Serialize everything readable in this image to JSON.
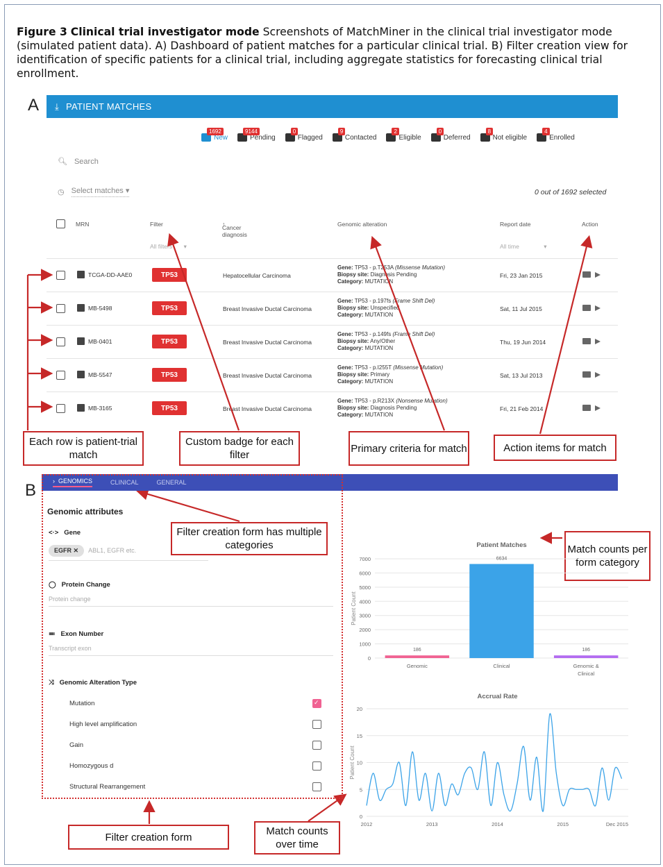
{
  "caption": {
    "label": "Figure 3",
    "title": "Clinical trial investigator mode",
    "text": "Screenshots of MatchMiner in the clinical trial investigator mode (simulated patient data). A) Dashboard of patient matches for a particular clinical trial. B) Filter creation view for identification of specific patients for a clinical trial, including aggregate statistics for forecasting clinical trial enrollment."
  },
  "panel_a": {
    "letter": "A",
    "header": "PATIENT MATCHES",
    "statuses": [
      {
        "label": "New",
        "count": "1692",
        "color": "#1f8fd1"
      },
      {
        "label": "Pending",
        "count": "9144",
        "color": "#333333"
      },
      {
        "label": "Flagged",
        "count": "0",
        "color": "#333333"
      },
      {
        "label": "Contacted",
        "count": "9",
        "color": "#333333"
      },
      {
        "label": "Eligible",
        "count": "2",
        "color": "#333333"
      },
      {
        "label": "Deferred",
        "count": "0",
        "color": "#333333"
      },
      {
        "label": "Not eligible",
        "count": "8",
        "color": "#333333"
      },
      {
        "label": "Enrolled",
        "count": "4",
        "color": "#333333"
      }
    ],
    "search_placeholder": "Search",
    "select_matches": "Select matches",
    "selected_count": "0 out of 1692 selected",
    "columns": {
      "mrn": "MRN",
      "filter": "Filter",
      "cancer": "Cancer diagnosis",
      "genomic": "Genomic alteration",
      "report": "Report date",
      "action": "Action"
    },
    "filter_all": "All filters",
    "time_all": "All time",
    "rows": [
      {
        "mrn": "TCGA-DD-AAE0",
        "badge": "TP53",
        "diagnosis": "Hepatocellular Carcinoma",
        "gene": "TP53 - p.T253A",
        "gene_type": "(Missense Mutation)",
        "biopsy": "Diagnosis Pending",
        "category": "MUTATION",
        "date": "Fri, 23 Jan 2015"
      },
      {
        "mrn": "MB-5498",
        "badge": "TP53",
        "diagnosis": "Breast Invasive Ductal Carcinoma",
        "gene": "TP53 - p.197fs",
        "gene_type": "(Frame Shift Del)",
        "biopsy": "Unspecified",
        "category": "MUTATION",
        "date": "Sat, 11 Jul 2015"
      },
      {
        "mrn": "MB-0401",
        "badge": "TP53",
        "diagnosis": "Breast Invasive Ductal Carcinoma",
        "gene": "TP53 - p.149fs",
        "gene_type": "(Frame Shift Del)",
        "biopsy": "Any/Other",
        "category": "MUTATION",
        "date": "Thu, 19 Jun 2014"
      },
      {
        "mrn": "MB-5547",
        "badge": "TP53",
        "diagnosis": "Breast Invasive Ductal Carcinoma",
        "gene": "TP53 - p.I255T",
        "gene_type": "(Missense Mutation)",
        "biopsy": "Primary",
        "category": "MUTATION",
        "date": "Sat, 13 Jul 2013"
      },
      {
        "mrn": "MB-3165",
        "badge": "TP53",
        "diagnosis": "Breast Invasive Ductal Carcinoma",
        "gene": "TP53 - p.R213X",
        "gene_type": "(Nonsense Mutation)",
        "biopsy": "Diagnosis Pending",
        "category": "MUTATION",
        "date": "Fri, 21 Feb 2014"
      }
    ],
    "labels": {
      "gene": "Gene:",
      "biopsy": "Biopsy site:",
      "category": "Category:"
    },
    "callouts": {
      "rows": "Each row is patient-trial match",
      "badge": "Custom badge for each filter",
      "criteria": "Primary criteria for match",
      "actions": "Action items for match"
    }
  },
  "panel_b": {
    "letter": "B",
    "tabs": [
      "GENOMICS",
      "CLINICAL",
      "GENERAL"
    ],
    "form_title": "Genomic attributes",
    "gene_label": "Gene",
    "gene_chip": "EGFR",
    "gene_hint": "ABL1, EGFR etc.",
    "protein_label": "Protein Change",
    "protein_hint": "Protein change",
    "exon_label": "Exon Number",
    "exon_hint": "Transcript exon",
    "alt_type_label": "Genomic Alteration Type",
    "alt_types": [
      {
        "label": "Mutation",
        "checked": true
      },
      {
        "label": "High level amplification",
        "checked": false
      },
      {
        "label": "Gain",
        "checked": false
      },
      {
        "label": "Homozygous d",
        "checked": false
      },
      {
        "label": "Structural Rearrangement",
        "checked": false
      }
    ],
    "callouts": {
      "categories": "Filter creation form has multiple categories",
      "match_counts": "Match counts per form category",
      "form": "Filter creation form",
      "over_time": "Match counts over time"
    }
  },
  "chart_data": [
    {
      "type": "bar",
      "title": "Patient Matches",
      "ylabel": "Patient Count",
      "xlabel": "",
      "categories": [
        "Genomic",
        "Clinical",
        "Genomic & Clinical"
      ],
      "values": [
        186,
        6634,
        186
      ],
      "colors": [
        "#f06292",
        "#3ba3e8",
        "#b36cf0"
      ],
      "ylim": [
        0,
        7000
      ],
      "yticks": [
        0,
        1000,
        2000,
        3000,
        4000,
        5000,
        6000,
        7000
      ],
      "grid": true
    },
    {
      "type": "line",
      "title": "Accrual Rate",
      "ylabel": "Patient Count",
      "xlabel": "",
      "xticks": [
        "2012",
        "2013",
        "2014",
        "2015",
        "Dec 2015"
      ],
      "x": [
        2012.0,
        2012.1,
        2012.2,
        2012.3,
        2012.4,
        2012.5,
        2012.6,
        2012.7,
        2012.8,
        2012.9,
        2013.0,
        2013.1,
        2013.2,
        2013.3,
        2013.4,
        2013.5,
        2013.6,
        2013.7,
        2013.8,
        2013.9,
        2014.0,
        2014.1,
        2014.2,
        2014.3,
        2014.4,
        2014.5,
        2014.6,
        2014.7,
        2014.8,
        2014.9,
        2015.0,
        2015.1,
        2015.2,
        2015.3,
        2015.4,
        2015.5,
        2015.6,
        2015.7,
        2015.8,
        2015.9
      ],
      "y": [
        2,
        8,
        3,
        5,
        6,
        10,
        2,
        12,
        3,
        8,
        1,
        8,
        2,
        6,
        4,
        8,
        9,
        5,
        12,
        2,
        10,
        4,
        1,
        6,
        13,
        3,
        11,
        1,
        19,
        8,
        2,
        5,
        5,
        5,
        5,
        2,
        9,
        3,
        9,
        7
      ],
      "ylim": [
        0,
        20
      ],
      "yticks": [
        0,
        5,
        10,
        15,
        20
      ],
      "color": "#3ba3e8",
      "grid": true
    }
  ]
}
